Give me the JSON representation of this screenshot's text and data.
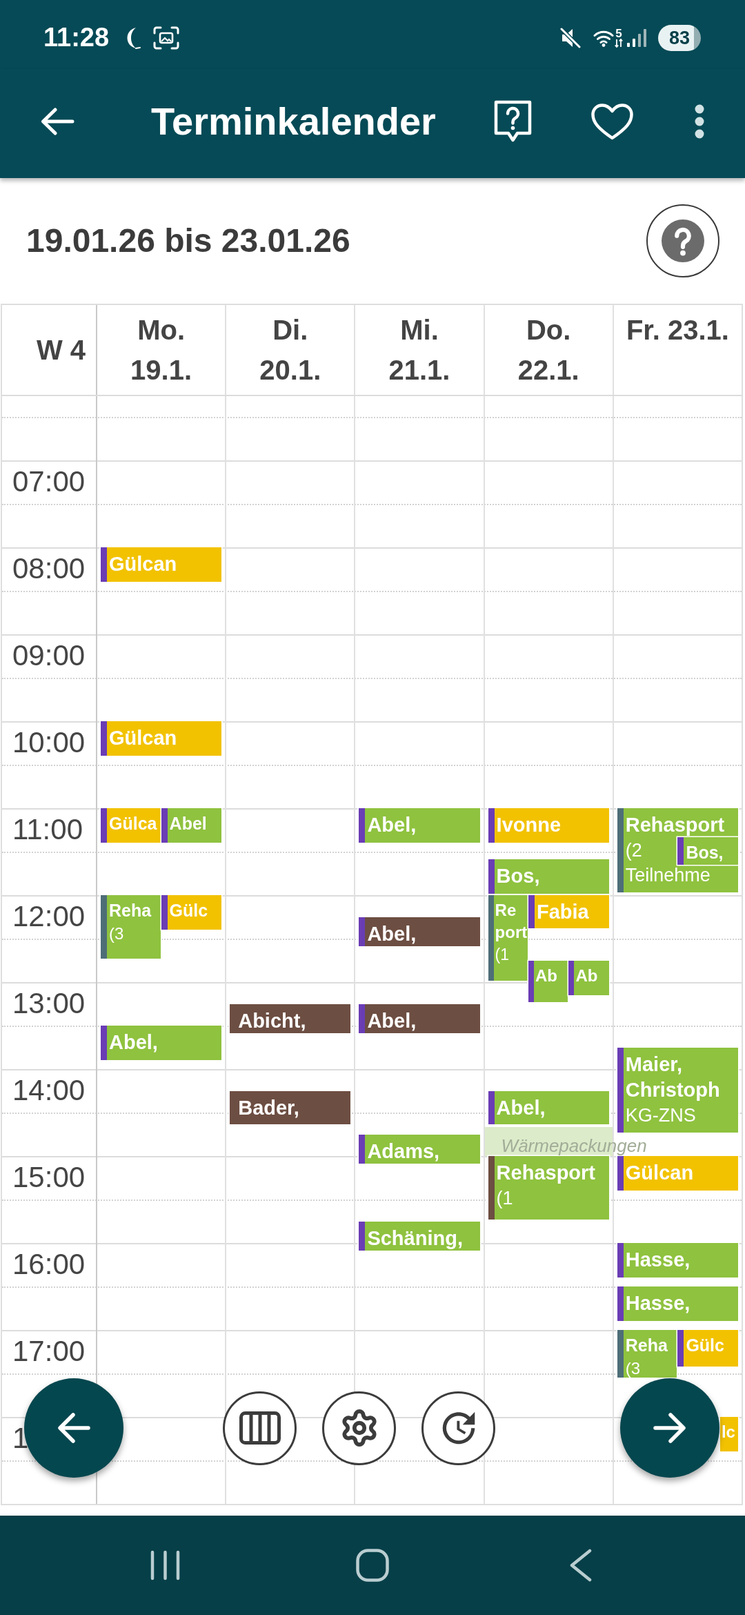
{
  "status_bar": {
    "time": "11:28",
    "network_label": "5",
    "battery": "83"
  },
  "app_bar": {
    "title": "Terminkalender"
  },
  "date_range": {
    "text": "19.01.26 bis 23.01.26"
  },
  "calendar": {
    "week_label": "W 4",
    "hours": [
      "07:00",
      "08:00",
      "09:00",
      "10:00",
      "11:00",
      "12:00",
      "13:00",
      "14:00",
      "15:00",
      "16:00",
      "17:00",
      "1"
    ],
    "days": [
      {
        "header": [
          "Mo.",
          "19.1."
        ],
        "entries": [
          {
            "kind": "appointment",
            "title": [
              "Gülcan"
            ],
            "color": "#f2c200",
            "stripe": {
              "color": "#6a3db5"
            }
          },
          {
            "kind": "appointment",
            "title": [
              "Gülcan"
            ],
            "color": "#f2c200",
            "stripe": {
              "color": "#6a3db5"
            }
          },
          {
            "kind": "appointment",
            "title": [
              "Gülca"
            ],
            "color": "#f2c200",
            "stripe": {
              "color": "#6a3db5"
            }
          },
          {
            "kind": "appointment",
            "title": [
              "Abel"
            ],
            "color": "#8fc23f",
            "stripe": {
              "color": "#6a3db5"
            }
          },
          {
            "kind": "appointment",
            "title": [
              "Reha"
            ],
            "details": [
              "(3"
            ],
            "color": "#8fc23f",
            "stripe": {
              "color": "#4e6e77"
            }
          },
          {
            "kind": "appointment",
            "title": [
              "Gülc"
            ],
            "color": "#f2c200",
            "stripe": {
              "color": "#6a3db5"
            }
          },
          {
            "kind": "appointment",
            "title": [
              "Abel,"
            ],
            "color": "#8fc23f",
            "stripe": {
              "color": "#6a3db5"
            }
          }
        ]
      },
      {
        "header": [
          "Di.",
          "20.1."
        ],
        "entries": [
          {
            "kind": "appointment",
            "title": [
              "Abicht,"
            ],
            "color": "#6d4e42"
          },
          {
            "kind": "appointment",
            "title": [
              "Bader,"
            ],
            "color": "#6d4e42"
          }
        ]
      },
      {
        "header": [
          "Mi.",
          "21.1."
        ],
        "entries": [
          {
            "kind": "appointment",
            "title": [
              "Abel,"
            ],
            "color": "#8fc23f",
            "stripe": {
              "color": "#6a3db5"
            }
          },
          {
            "kind": "appointment",
            "title": [
              "Abel,"
            ],
            "color": "#6d4e42",
            "stripe": {
              "color": "#6a3db5"
            }
          },
          {
            "kind": "appointment",
            "title": [
              "Abel,"
            ],
            "color": "#6d4e42",
            "stripe": {
              "color": "#6a3db5"
            }
          },
          {
            "kind": "appointment",
            "title": [
              "Adams,"
            ],
            "color": "#8fc23f",
            "stripe": {
              "color": "#6a3db5"
            }
          },
          {
            "kind": "appointment",
            "title": [
              "Schäning,"
            ],
            "color": "#8fc23f",
            "stripe": {
              "color": "#6a3db5"
            }
          }
        ]
      },
      {
        "header": [
          "Do.",
          "22.1."
        ],
        "entries": [
          {
            "kind": "appointment",
            "title": [
              "Ivonne"
            ],
            "color": "#f2c200",
            "stripe": {
              "color": "#6a3db5"
            }
          },
          {
            "kind": "appointment",
            "title": [
              "Bos,"
            ],
            "color": "#8fc23f",
            "stripe": {
              "color": "#6a3db5"
            }
          },
          {
            "kind": "appointment",
            "title": [
              "Re",
              "port"
            ],
            "details": [
              "(1"
            ],
            "color": "#8fc23f",
            "stripe": {
              "color": "#4e6e77"
            }
          },
          {
            "kind": "appointment",
            "title": [
              "Fabia"
            ],
            "color": "#f2c200",
            "stripe": {
              "color": "#6a3db5"
            }
          },
          {
            "kind": "appointment",
            "title": [
              "Ab"
            ],
            "color": "#8fc23f",
            "stripe": {
              "color": "#6a3db5"
            }
          },
          {
            "kind": "appointment",
            "title": [
              "Ab"
            ],
            "color": "#8fc23f",
            "stripe": {
              "color": "#6a3db5"
            }
          },
          {
            "kind": "appointment",
            "title": [
              "Abel,"
            ],
            "color": "#8fc23f",
            "stripe": {
              "color": "#6a3db5"
            }
          },
          {
            "kind": "slot",
            "label": "Wärmepackungen",
            "color": "#dcebc9"
          },
          {
            "kind": "appointment",
            "title": [
              "Rehasport"
            ],
            "details": [
              "(1"
            ],
            "color": "#8fc23f",
            "stripe": {
              "color": "#6d4e42"
            }
          }
        ]
      },
      {
        "header": [
          "Fr. 23.1."
        ],
        "entries": [
          {
            "kind": "appointment",
            "title": [
              "Rehasport"
            ],
            "details": [
              "(2",
              "Teilnehme"
            ],
            "color": "#8fc23f",
            "stripe": {
              "color": "#4e6e77"
            }
          },
          {
            "kind": "appointment",
            "title": [
              "Bos,"
            ],
            "color": "#8fc23f",
            "stripe": {
              "color": "#6a3db5"
            }
          },
          {
            "kind": "appointment",
            "title": [
              "Maier,",
              "Christoph"
            ],
            "details": [
              "KG-ZNS"
            ],
            "color": "#8fc23f",
            "stripe": {
              "color": "#6a3db5"
            }
          },
          {
            "kind": "appointment",
            "title": [
              "Gülcan"
            ],
            "color": "#f2c200",
            "stripe": {
              "color": "#6a3db5"
            }
          },
          {
            "kind": "appointment",
            "title": [
              "Hasse,"
            ],
            "color": "#8fc23f",
            "stripe": {
              "color": "#6a3db5"
            }
          },
          {
            "kind": "appointment",
            "title": [
              "Hasse,"
            ],
            "color": "#8fc23f",
            "stripe": {
              "color": "#6a3db5"
            }
          },
          {
            "kind": "appointment",
            "title": [
              "Reha"
            ],
            "details": [
              "(3"
            ],
            "color": "#8fc23f",
            "stripe": {
              "color": "#4e6e77"
            }
          },
          {
            "kind": "appointment",
            "title": [
              "Gülc"
            ],
            "color": "#f2c200",
            "stripe": {
              "color": "#6a3db5"
            }
          },
          {
            "kind": "appointment",
            "title": [
              "lc"
            ],
            "color": "#f2c200"
          }
        ]
      }
    ]
  }
}
